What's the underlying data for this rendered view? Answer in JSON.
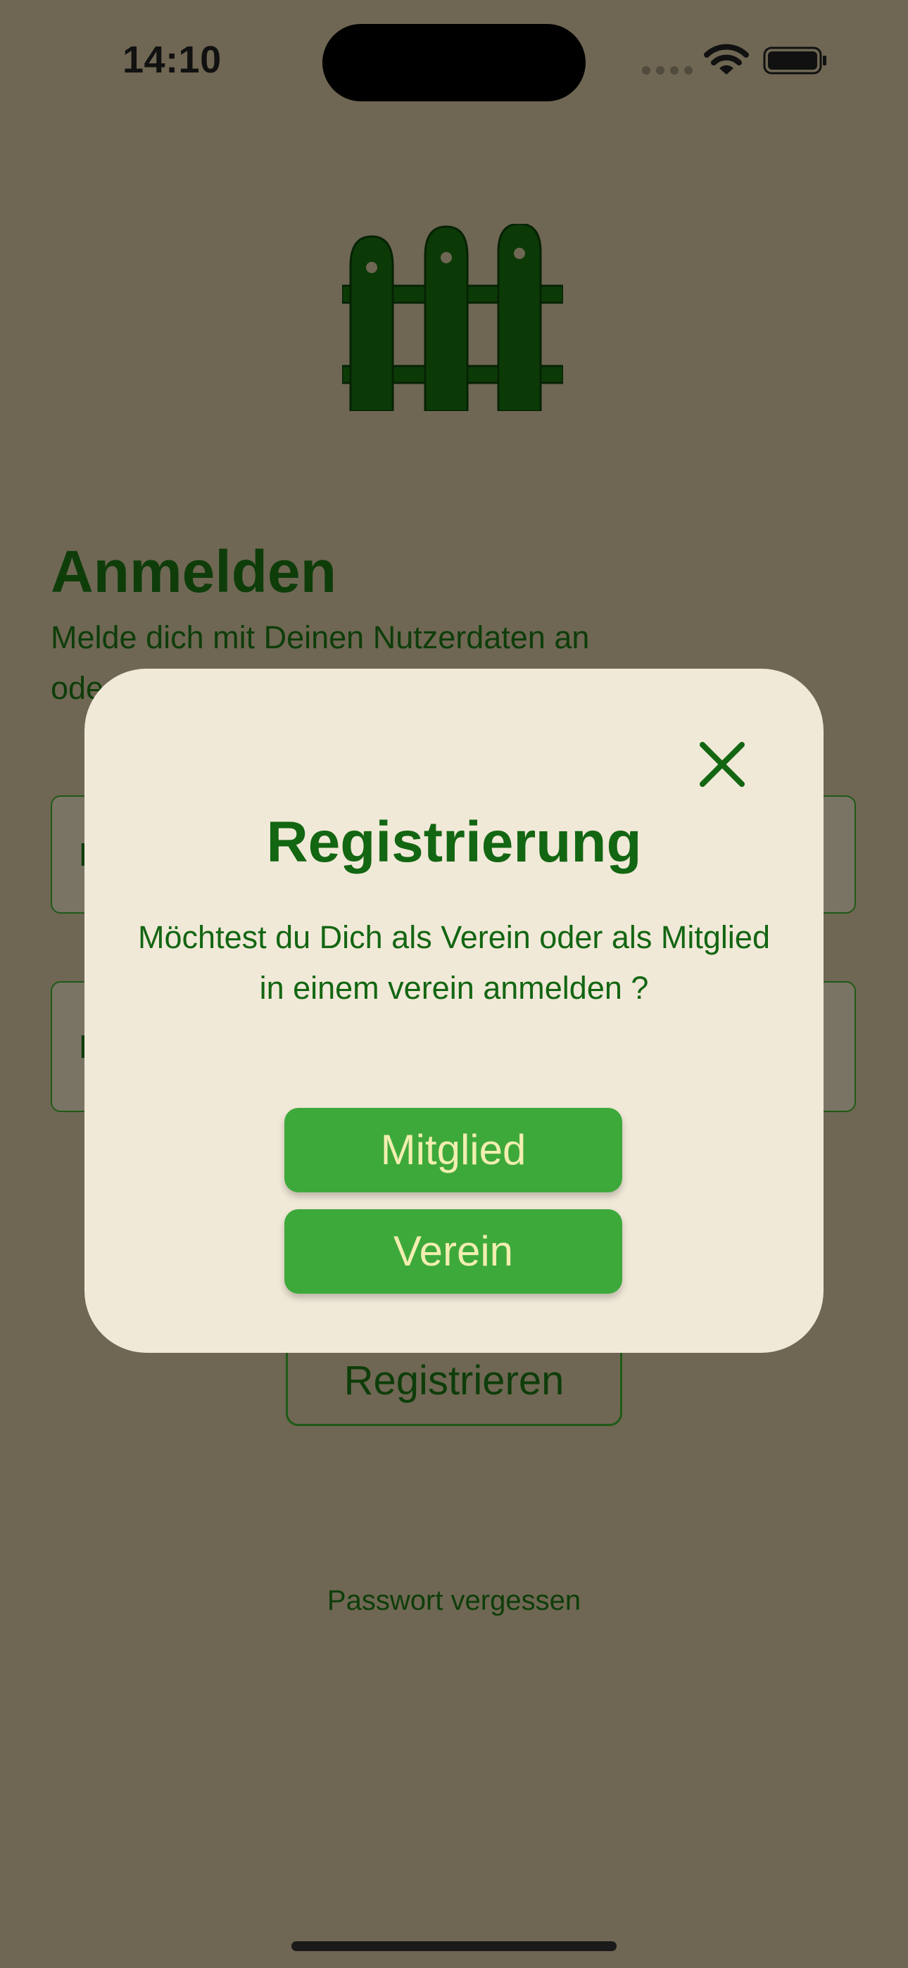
{
  "status_bar": {
    "time": "14:10"
  },
  "login": {
    "title": "Anmelden",
    "subtitle": "Melde dich mit Deinen Nutzerdaten an\node",
    "email_placeholder": "E",
    "password_placeholder": "P",
    "register_label": "Registrieren",
    "forgot_password_label": "Passwort vergessen"
  },
  "modal": {
    "title": "Registrierung",
    "question": "Möchtest du Dich als Verein oder als Mitglied in einem verein anmelden ?",
    "member_button_label": "Mitglied",
    "club_button_label": "Verein"
  },
  "colors": {
    "background": "#6f6753",
    "dark_green": "#0e3d0a",
    "modal_background": "#f1e9d8",
    "modal_text": "#136612",
    "button_green": "#3da93a",
    "button_text": "#f2eeb0"
  },
  "icons": {
    "logo": "fence-icon",
    "close": "close-icon",
    "wifi": "wifi-icon",
    "battery": "battery-icon",
    "signal": "cellular-signal-icon"
  }
}
